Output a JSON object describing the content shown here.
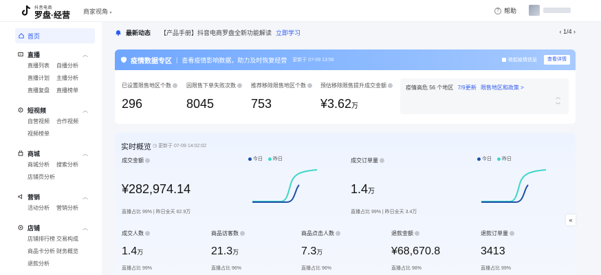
{
  "header": {
    "logo_small": "抖音电商",
    "logo_main": "罗盘·经营",
    "role_switch": "商家视角",
    "help": "帮助"
  },
  "sidebar": {
    "home": "首页",
    "groups": [
      {
        "label": "直播",
        "icon": "live-icon",
        "items": [
          [
            "直播列表",
            "自播分析"
          ],
          [
            "直播计划",
            "主播分析"
          ],
          [
            "直播复盘",
            "直播榜单"
          ]
        ]
      },
      {
        "label": "短视频",
        "icon": "video-icon",
        "items": [
          [
            "自营视频",
            "合作视频"
          ],
          [
            "视频榜单"
          ]
        ]
      },
      {
        "label": "商城",
        "icon": "mall-icon",
        "items": [
          [
            "商城分析",
            "搜索分析"
          ],
          [
            "店铺页分析"
          ]
        ]
      },
      {
        "label": "营销",
        "icon": "marketing-icon",
        "items": [
          [
            "活动分析",
            "营销分析"
          ]
        ]
      },
      {
        "label": "店铺",
        "icon": "shop-icon",
        "items": [
          [
            "店铺排行榜",
            "交易构成"
          ],
          [
            "商品卡分析",
            "财务概览"
          ],
          [
            "退款分析"
          ]
        ]
      }
    ]
  },
  "announce": {
    "label": "最新动态",
    "text": "【产品手册】抖音电商罗盘全新功能解读",
    "link": "立即学习",
    "pager": "1/4"
  },
  "epidemic": {
    "title": "疫情数据专区",
    "subtitle": "查看疫情影响数据，助力及时恢复经营",
    "updated": "更新于 07-09 13:56",
    "close_info": "收起疫情信息",
    "detail_btn": "查看详情",
    "metrics": [
      {
        "label": "已设置限售地区个数",
        "value": "296",
        "unit": ""
      },
      {
        "label": "因限售下单失败次数",
        "value": "8045",
        "unit": ""
      },
      {
        "label": "推荐移除限售地区个数",
        "value": "753",
        "unit": ""
      },
      {
        "label": "预估移除限售提升成交金额",
        "value": "¥3.62",
        "unit": "万"
      }
    ],
    "panel": {
      "text": "疫情高危 56 个地区",
      "date": "7/9更新",
      "link": "限售地区和政策 >"
    }
  },
  "realtime": {
    "title": "实时概览",
    "updated": "更新于 07-09 14:02:02",
    "legend": [
      "今日",
      "昨日"
    ],
    "big": [
      {
        "label": "成交金额",
        "value": "¥282,974.14",
        "unit": "",
        "foot": "直播占比 99%  |  昨日全天 62.9万"
      },
      {
        "label": "成交订单量",
        "value": "1.4",
        "unit": "万",
        "foot": "直播占比 99%  |  昨日全天 3.4万"
      }
    ],
    "small": [
      {
        "label": "成交人数",
        "value": "1.4",
        "unit": "万",
        "foot": "直播占比 99%"
      },
      {
        "label": "商品访客数",
        "value": "21.3",
        "unit": "万",
        "foot": "直播占比 96%"
      },
      {
        "label": "商品点击人数",
        "value": "7.3",
        "unit": "万",
        "foot": "直播占比 96%"
      },
      {
        "label": "退款金额",
        "value": "¥68,670.8",
        "unit": "",
        "foot": "直播占比 98%"
      },
      {
        "label": "退款订单量",
        "value": "3413",
        "unit": "",
        "foot": "直播占比 99%"
      }
    ]
  },
  "colors": {
    "accent": "#2f5cf0",
    "today_line": "#1e4fa8",
    "yesterday_line": "#3ed6c8"
  }
}
